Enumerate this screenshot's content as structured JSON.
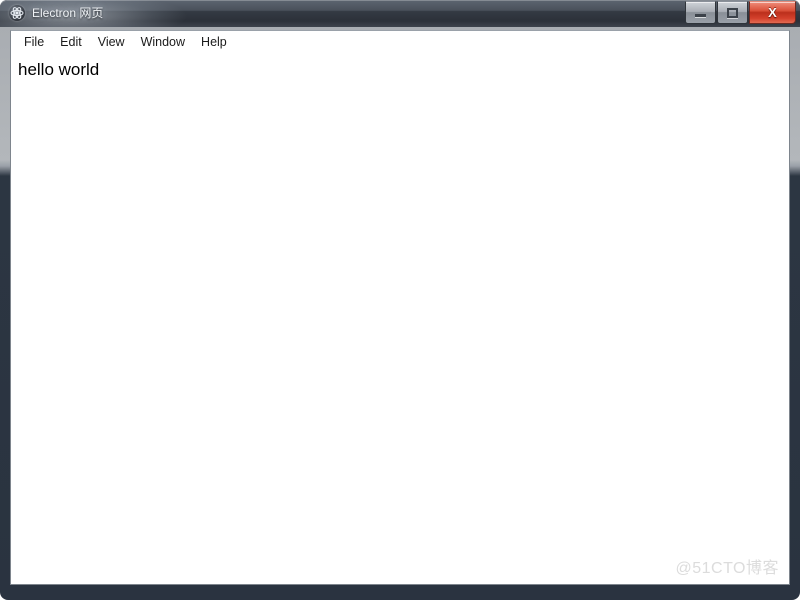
{
  "window": {
    "title": "Electron 网页",
    "icon": "electron-atom-icon",
    "controls": {
      "minimize_label": "—",
      "maximize_label": "□",
      "close_label": "X",
      "close_color": "#cc3a22"
    }
  },
  "menubar": {
    "items": [
      {
        "label": "File"
      },
      {
        "label": "Edit"
      },
      {
        "label": "View"
      },
      {
        "label": "Window"
      },
      {
        "label": "Help"
      }
    ]
  },
  "content": {
    "body_text": "hello world"
  },
  "watermark": {
    "text": "@51CTO博客",
    "color": "#dcdcdc"
  }
}
